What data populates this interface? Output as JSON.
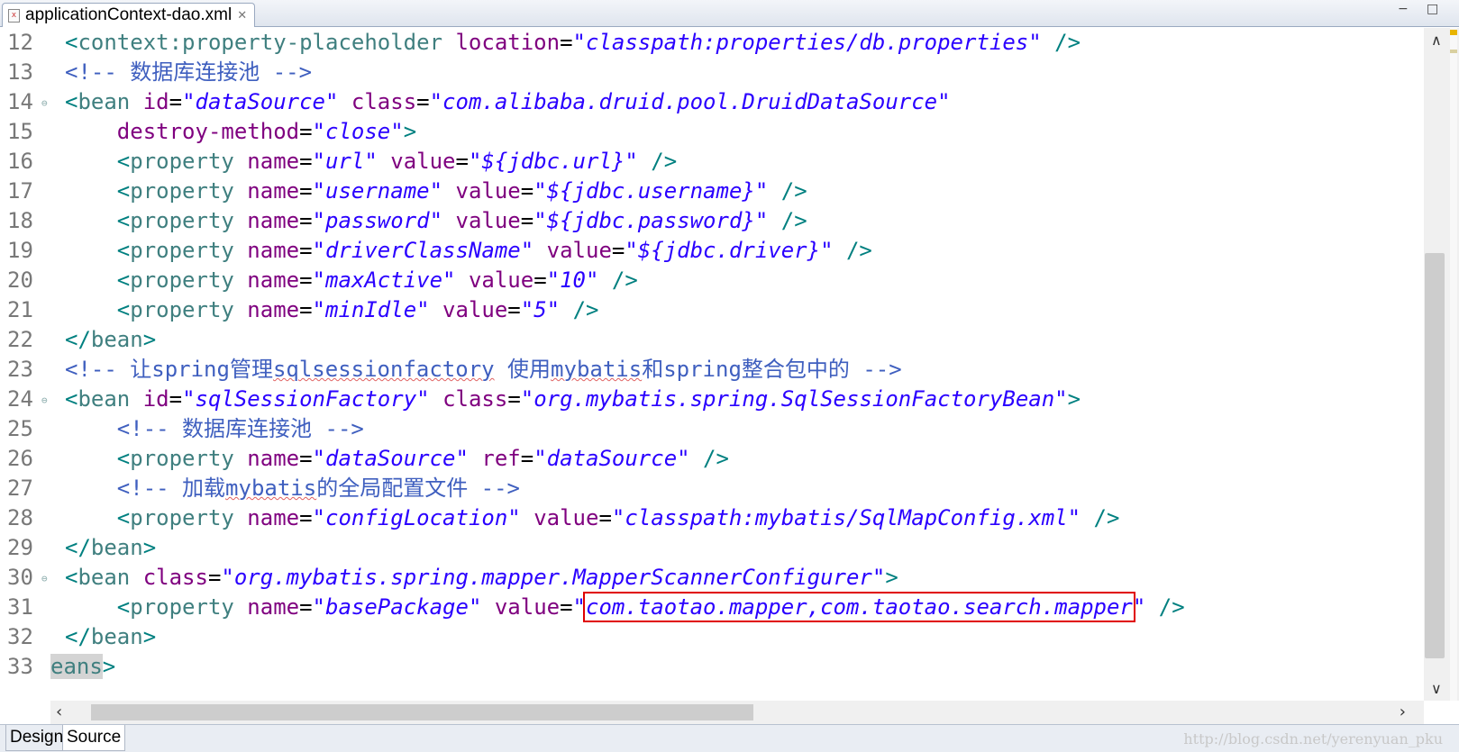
{
  "tab": {
    "title": "applicationContext-dao.xml",
    "file_icon": "xml-file-icon",
    "close_glyph": "✕"
  },
  "window_controls": {
    "minimize": "−",
    "maximize": "□"
  },
  "editor": {
    "lines": [
      {
        "n": "12",
        "html": "<span class='t'>&lt;</span><span class='tn'>context:property-placeholder</span> <span class='a'>location</span><span class='eq'>=</span><span class='s'>\"classpath:properties/db.properties\"</span> <span class='t'>/&gt;</span>"
      },
      {
        "n": "13",
        "html": "<span class='c'>&lt;!-- 数据库连接池 --&gt;</span>"
      },
      {
        "n": "14",
        "fold": true,
        "html": "<span class='t'>&lt;</span><span class='tn'>bean</span> <span class='a'>id</span><span class='eq'>=</span><span class='s'>\"dataSource\"</span> <span class='a'>class</span><span class='eq'>=</span><span class='s'>\"com.alibaba.druid.pool.DruidDataSource\"</span>"
      },
      {
        "n": "15",
        "html": "    <span class='a'>destroy-method</span><span class='eq'>=</span><span class='s'>\"close\"</span><span class='t'>&gt;</span>"
      },
      {
        "n": "16",
        "html": "    <span class='t'>&lt;</span><span class='tn'>property</span> <span class='a'>name</span><span class='eq'>=</span><span class='s'>\"url\"</span> <span class='a'>value</span><span class='eq'>=</span><span class='s'>\"${jdbc.url}\"</span> <span class='t'>/&gt;</span>"
      },
      {
        "n": "17",
        "html": "    <span class='t'>&lt;</span><span class='tn'>property</span> <span class='a'>name</span><span class='eq'>=</span><span class='s'>\"username\"</span> <span class='a'>value</span><span class='eq'>=</span><span class='s'>\"${jdbc.username}\"</span> <span class='t'>/&gt;</span>"
      },
      {
        "n": "18",
        "html": "    <span class='t'>&lt;</span><span class='tn'>property</span> <span class='a'>name</span><span class='eq'>=</span><span class='s'>\"password\"</span> <span class='a'>value</span><span class='eq'>=</span><span class='s'>\"${jdbc.password}\"</span> <span class='t'>/&gt;</span>"
      },
      {
        "n": "19",
        "html": "    <span class='t'>&lt;</span><span class='tn'>property</span> <span class='a'>name</span><span class='eq'>=</span><span class='s'>\"driverClassName\"</span> <span class='a'>value</span><span class='eq'>=</span><span class='s'>\"${jdbc.driver}\"</span> <span class='t'>/&gt;</span>"
      },
      {
        "n": "20",
        "html": "    <span class='t'>&lt;</span><span class='tn'>property</span> <span class='a'>name</span><span class='eq'>=</span><span class='s'>\"maxActive\"</span> <span class='a'>value</span><span class='eq'>=</span><span class='s'>\"10\"</span> <span class='t'>/&gt;</span>"
      },
      {
        "n": "21",
        "html": "    <span class='t'>&lt;</span><span class='tn'>property</span> <span class='a'>name</span><span class='eq'>=</span><span class='s'>\"minIdle\"</span> <span class='a'>value</span><span class='eq'>=</span><span class='s'>\"5\"</span> <span class='t'>/&gt;</span>"
      },
      {
        "n": "22",
        "html": "<span class='t'>&lt;/</span><span class='tn'>bean</span><span class='t'>&gt;</span>"
      },
      {
        "n": "23",
        "html": "<span class='c'>&lt;!-- 让spring管理<span class='sq'>sqlsessionfactory</span> 使用<span class='sq'>mybatis</span>和spring整合包中的 --&gt;</span>"
      },
      {
        "n": "24",
        "fold": true,
        "html": "<span class='t'>&lt;</span><span class='tn'>bean</span> <span class='a'>id</span><span class='eq'>=</span><span class='s'>\"sqlSessionFactory\"</span> <span class='a'>class</span><span class='eq'>=</span><span class='s'>\"org.mybatis.spring.SqlSessionFactoryBean\"</span><span class='t'>&gt;</span>"
      },
      {
        "n": "25",
        "html": "    <span class='c'>&lt;!-- 数据库连接池 --&gt;</span>"
      },
      {
        "n": "26",
        "html": "    <span class='t'>&lt;</span><span class='tn'>property</span> <span class='a'>name</span><span class='eq'>=</span><span class='s'>\"dataSource\"</span> <span class='a'>ref</span><span class='eq'>=</span><span class='s'>\"dataSource\"</span> <span class='t'>/&gt;</span>"
      },
      {
        "n": "27",
        "html": "    <span class='c'>&lt;!-- 加载<span class='sq'>mybatis</span>的全局配置文件 --&gt;</span>"
      },
      {
        "n": "28",
        "html": "    <span class='t'>&lt;</span><span class='tn'>property</span> <span class='a'>name</span><span class='eq'>=</span><span class='s'>\"configLocation\"</span> <span class='a'>value</span><span class='eq'>=</span><span class='s'>\"classpath:mybatis/SqlMapConfig.xml\"</span> <span class='t'>/&gt;</span>"
      },
      {
        "n": "29",
        "html": "<span class='t'>&lt;/</span><span class='tn'>bean</span><span class='t'>&gt;</span>"
      },
      {
        "n": "30",
        "fold": true,
        "html": "<span class='t'>&lt;</span><span class='tn'>bean</span> <span class='a'>class</span><span class='eq'>=</span><span class='s'>\"org.mybatis.spring.mapper.MapperScannerConfigurer\"</span><span class='t'>&gt;</span>"
      },
      {
        "n": "31",
        "html": "    <span class='t'>&lt;</span><span class='tn'>property</span> <span class='a'>name</span><span class='eq'>=</span><span class='s'>\"basePackage\"</span> <span class='a'>value</span><span class='eq'>=</span><span class='s'>\"<span class='hl-box'>com.taotao.mapper,com.taotao.search.mapper</span>\"</span> <span class='t'>/&gt;</span>"
      },
      {
        "n": "32",
        "html": "<span class='t'>&lt;/</span><span class='tn'>bean</span><span class='t'>&gt;</span>"
      },
      {
        "n": "33",
        "offset": -16,
        "html": "<span class='sel-frag'>eans</span><span class='t'>&gt;</span>"
      }
    ]
  },
  "bottom_tabs": [
    {
      "label": "Design",
      "active": false
    },
    {
      "label": "Source",
      "active": true
    }
  ],
  "watermark": "http://blog.csdn.net/yerenyuan_pku"
}
